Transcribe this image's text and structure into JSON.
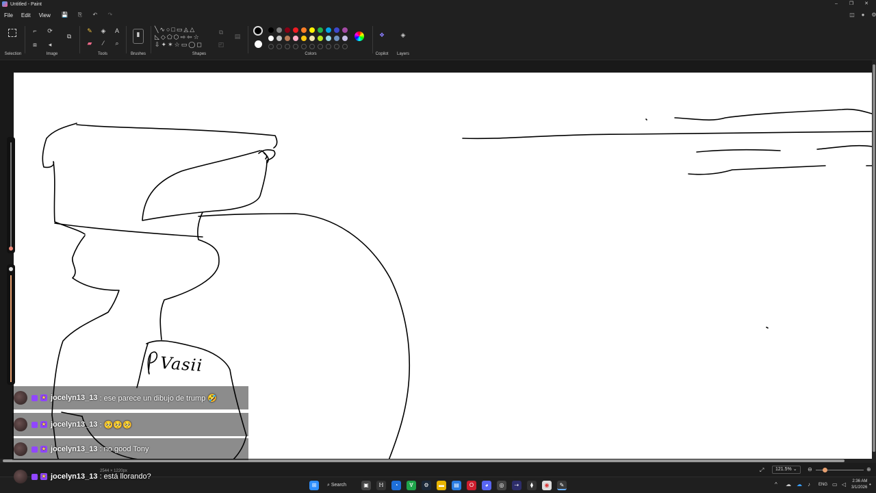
{
  "window": {
    "title": "Untitled - Paint",
    "controls": [
      "–",
      "❐",
      "✕"
    ]
  },
  "menu": {
    "items": [
      "File",
      "Edit",
      "View"
    ]
  },
  "ribbon": {
    "groups": {
      "selection": "Selection",
      "image": "Image",
      "tools": "Tools",
      "brushes": "Brushes",
      "shapes": "Shapes",
      "colors": "Colors",
      "copilot": "Copilot",
      "layers": "Layers"
    },
    "palette_row1": [
      "#000000",
      "#7f7f7f",
      "#880015",
      "#ed1c24",
      "#ff7f27",
      "#fff200",
      "#22b14c",
      "#00a2e8",
      "#3f48cc",
      "#a349a4"
    ],
    "palette_row2": [
      "#ffffff",
      "#c3c3c3",
      "#b97a57",
      "#ffaec9",
      "#ffc90e",
      "#efe4b0",
      "#b5e61d",
      "#99d9ea",
      "#7092be",
      "#c8bfe7"
    ],
    "primary_color": "#000000",
    "secondary_color": "#ffffff"
  },
  "status": {
    "zoom": "121.5%",
    "dimensions": "2544 × 1220px"
  },
  "canvas": {
    "text": "Vasii"
  },
  "chat": [
    {
      "user": "jocelyn13_13",
      "message": ": ese parece un dibujo de trump 🤣"
    },
    {
      "user": "jocelyn13_13",
      "message": ": 🥺🥺🥺"
    },
    {
      "user": "jocelyn13_13",
      "message": ": no good Tony"
    },
    {
      "user": "jocelyn13_13",
      "message": ": está llorando?"
    }
  ],
  "taskbar": {
    "search_label": "Search",
    "language": "ENG",
    "time": "2:36 AM",
    "date": "3/1/2026"
  }
}
